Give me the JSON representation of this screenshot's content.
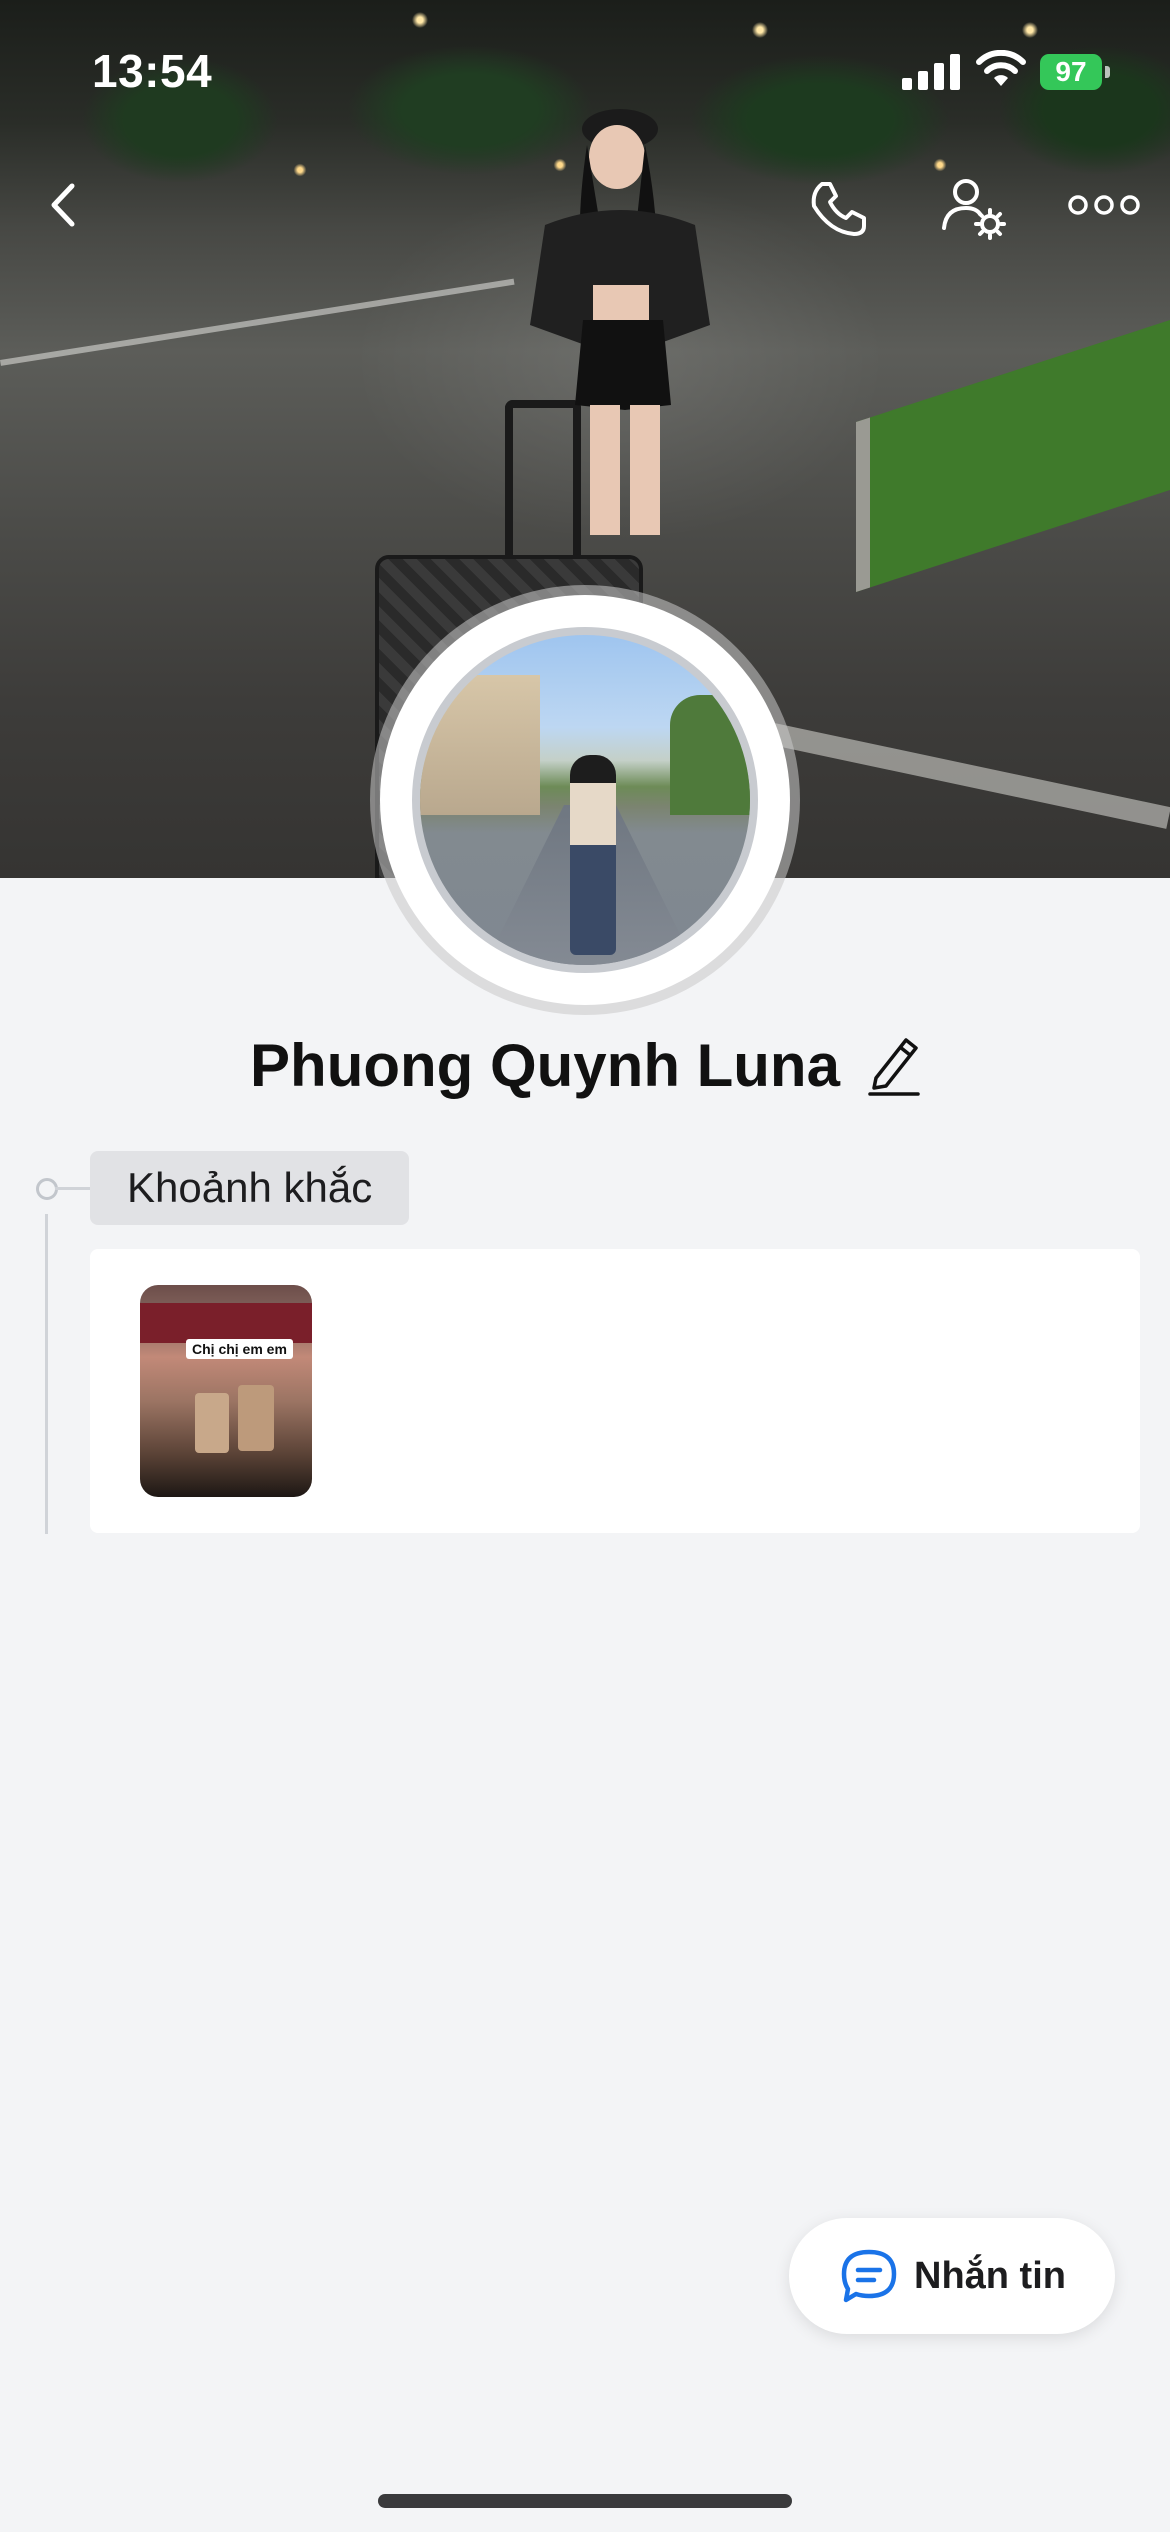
{
  "status_bar": {
    "time": "13:54",
    "battery": "97",
    "icons": [
      "cellular-signal-icon",
      "wifi-icon",
      "battery-charging-icon"
    ]
  },
  "nav": {
    "icons": [
      "chevron-left-icon",
      "phone-icon",
      "friend-settings-icon",
      "more-horizontal-icon"
    ]
  },
  "profile": {
    "name": "Phuong Quynh Luna"
  },
  "moments": {
    "label": "Khoảnh khắc",
    "items": [
      {
        "caption": "Chị chị em em"
      }
    ]
  },
  "actions": {
    "message_label": "Nhắn tin"
  },
  "colors": {
    "background": "#f3f4f6",
    "accent": "#1a73e8",
    "battery": "#34c759"
  }
}
